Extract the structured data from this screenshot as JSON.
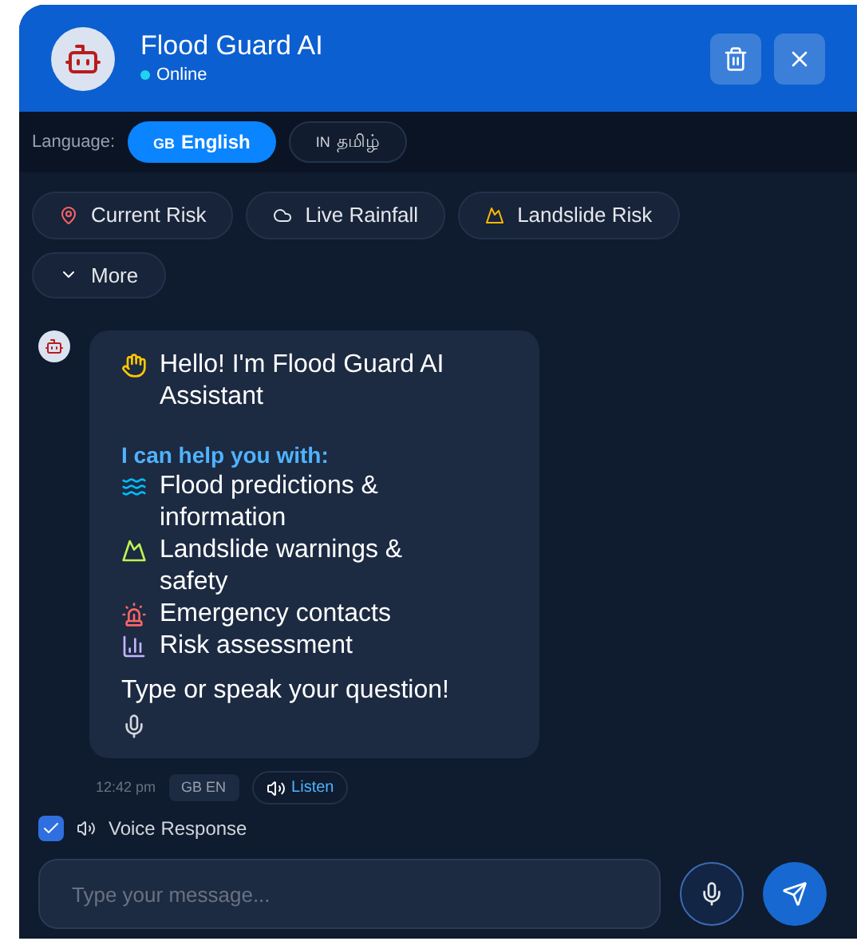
{
  "header": {
    "title": "Flood Guard AI",
    "status": "Online"
  },
  "language": {
    "label": "Language:",
    "options": [
      {
        "code": "GB",
        "name": "English",
        "selected": true
      },
      {
        "code": "IN",
        "name": "தமிழ்",
        "selected": false
      }
    ]
  },
  "quick_actions": [
    {
      "kind": "pin",
      "label": "Current Risk"
    },
    {
      "kind": "cloud",
      "label": "Live Rainfall"
    },
    {
      "kind": "mountain",
      "label": "Landslide Risk"
    },
    {
      "kind": "more",
      "label": "More"
    }
  ],
  "message": {
    "greeting": "Hello! I'm Flood Guard AI Assistant",
    "intro": "I can help you with:",
    "items": [
      {
        "kind": "wave",
        "text": "Flood predictions & information"
      },
      {
        "kind": "mountain",
        "text": "Landslide warnings & safety"
      },
      {
        "kind": "siren",
        "text": "Emergency contacts"
      },
      {
        "kind": "chart",
        "text": "Risk assessment"
      }
    ],
    "closing": "Type or speak your question!",
    "time": "12:42 pm",
    "lang_tag": "GB EN",
    "listen": "Listen"
  },
  "voice_response": {
    "label": "Voice Response",
    "checked": true
  },
  "composer": {
    "placeholder": "Type your message..."
  }
}
